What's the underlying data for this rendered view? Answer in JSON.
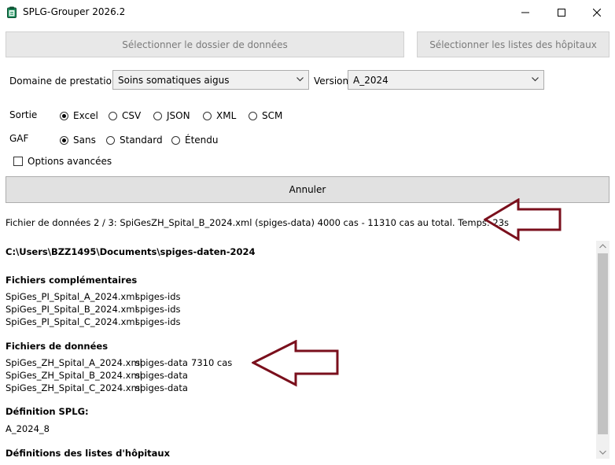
{
  "window": {
    "title": "SPLG-Grouper 2026.2",
    "icons": {
      "app": "clipboard-icon",
      "minimize": "minimize-icon",
      "maximize": "maximize-icon",
      "close": "close-icon"
    }
  },
  "toolbar": {
    "select_folder": "Sélectionner le dossier de données",
    "select_lists": "Sélectionner les listes des hôpitaux"
  },
  "domain": {
    "label": "Domaine de prestations",
    "value": "Soins somatiques aigus"
  },
  "version": {
    "label": "Version",
    "value": "A_2024"
  },
  "output": {
    "label": "Sortie",
    "options": [
      "Excel",
      "CSV",
      "JSON",
      "XML",
      "SCM"
    ],
    "selected": "Excel"
  },
  "gaf": {
    "label": "GAF",
    "options": [
      "Sans",
      "Standard",
      "Étendu"
    ],
    "selected": "Sans"
  },
  "advanced": {
    "label": "Options avancées",
    "checked": false
  },
  "cancel_label": "Annuler",
  "status": "Fichier de données 2 / 3: SpiGesZH_Spital_B_2024.xml  (spiges-data)  4000 cas - 11310 cas au total. Temps: 23s",
  "log": {
    "path": "C:\\Users\\BZZ1495\\Documents\\spiges-daten-2024",
    "complementary": {
      "heading": "Fichiers complémentaires",
      "files": [
        {
          "name": "SpiGes_PI_Spital_A_2024.xml",
          "type": "spiges-ids",
          "count": ""
        },
        {
          "name": "SpiGes_PI_Spital_B_2024.xml",
          "type": "spiges-ids",
          "count": ""
        },
        {
          "name": "SpiGes_PI_Spital_C_2024.xml",
          "type": "spiges-ids",
          "count": ""
        }
      ]
    },
    "data_files": {
      "heading": "Fichiers de données",
      "files": [
        {
          "name": "SpiGes_ZH_Spital_A_2024.xml",
          "type": "spiges-data",
          "count": "7310 cas"
        },
        {
          "name": "SpiGes_ZH_Spital_B_2024.xml",
          "type": "spiges-data",
          "count": ""
        },
        {
          "name": "SpiGes_ZH_Spital_C_2024.xml",
          "type": "spiges-data",
          "count": ""
        }
      ]
    },
    "splg_def": {
      "heading": "Définition SPLG:",
      "value": "A_2024_8"
    },
    "hospital_lists": {
      "heading": "Définitions des listes d'hôpitaux"
    }
  },
  "colors": {
    "arrow": "#7a0f1c",
    "button_bg": "#e8e8e8",
    "disabled_text": "#7a7a7a"
  }
}
